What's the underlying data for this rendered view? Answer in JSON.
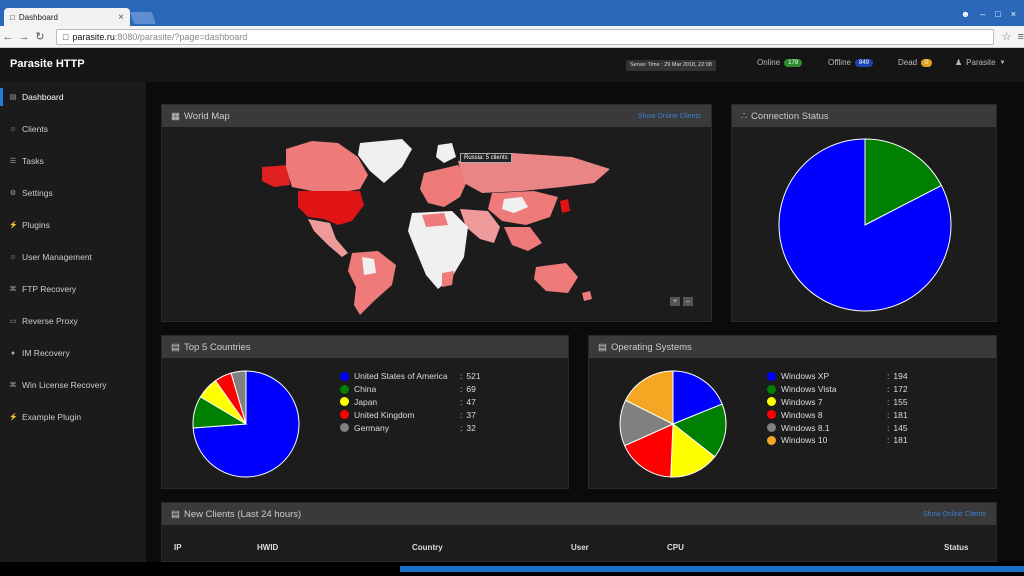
{
  "browser": {
    "tab_title": "Dashboard",
    "url_host": "parasite.ru",
    "url_rest": ":8080/parasite/?page=dashboard"
  },
  "app": {
    "brand": "Parasite HTTP",
    "server_time": "Server Time : 29 Mar 2018, 22:08",
    "online_label": "Online",
    "online_count": "179",
    "offline_label": "Offline",
    "offline_count": "849",
    "dead_label": "Dead",
    "dead_count": "0",
    "user_label": "Parasite"
  },
  "sidebar": {
    "items": [
      {
        "label": "Dashboard",
        "icon": "dashboard-icon"
      },
      {
        "label": "Clients",
        "icon": "users-icon"
      },
      {
        "label": "Tasks",
        "icon": "list-icon"
      },
      {
        "label": "Settings",
        "icon": "gear-icon"
      },
      {
        "label": "Plugins",
        "icon": "plug-icon"
      },
      {
        "label": "User Management",
        "icon": "users-icon"
      },
      {
        "label": "FTP Recovery",
        "icon": "key-icon"
      },
      {
        "label": "Reverse Proxy",
        "icon": "monitor-icon"
      },
      {
        "label": "IM Recovery",
        "icon": "chat-icon"
      },
      {
        "label": "Win License Recovery",
        "icon": "key-icon"
      },
      {
        "label": "Example Plugin",
        "icon": "plug-icon"
      }
    ]
  },
  "world_map": {
    "title": "World Map",
    "link": "Show Online Clients",
    "tooltip": "Russia: 5 clients"
  },
  "connection_status": {
    "title": "Connection Status",
    "slices": [
      {
        "value": 849,
        "color": "#0000ff"
      },
      {
        "value": 179,
        "color": "#008000"
      }
    ]
  },
  "top_countries": {
    "title": "Top 5 Countries",
    "items": [
      {
        "name": "United States of America",
        "value": 521,
        "color": "#0000ff"
      },
      {
        "name": "China",
        "value": 69,
        "color": "#008000"
      },
      {
        "name": "Japan",
        "value": 47,
        "color": "#ffff00"
      },
      {
        "name": "United Kingdom",
        "value": 37,
        "color": "#ff0000"
      },
      {
        "name": "Germany",
        "value": 32,
        "color": "#808080"
      }
    ]
  },
  "operating_systems": {
    "title": "Operating Systems",
    "items": [
      {
        "name": "Windows XP",
        "value": 194,
        "color": "#0000ff"
      },
      {
        "name": "Windows Vista",
        "value": 172,
        "color": "#008000"
      },
      {
        "name": "Windows 7",
        "value": 155,
        "color": "#ffff00"
      },
      {
        "name": "Windows 8",
        "value": 181,
        "color": "#ff0000"
      },
      {
        "name": "Windows 8.1",
        "value": 145,
        "color": "#808080"
      },
      {
        "name": "Windows 10",
        "value": 181,
        "color": "#f5a623"
      }
    ]
  },
  "new_clients": {
    "title": "New Clients (Last 24 hours)",
    "link": "Show Online Clients",
    "columns": [
      "IP",
      "HWID",
      "Country",
      "User",
      "CPU",
      "Status"
    ]
  }
}
